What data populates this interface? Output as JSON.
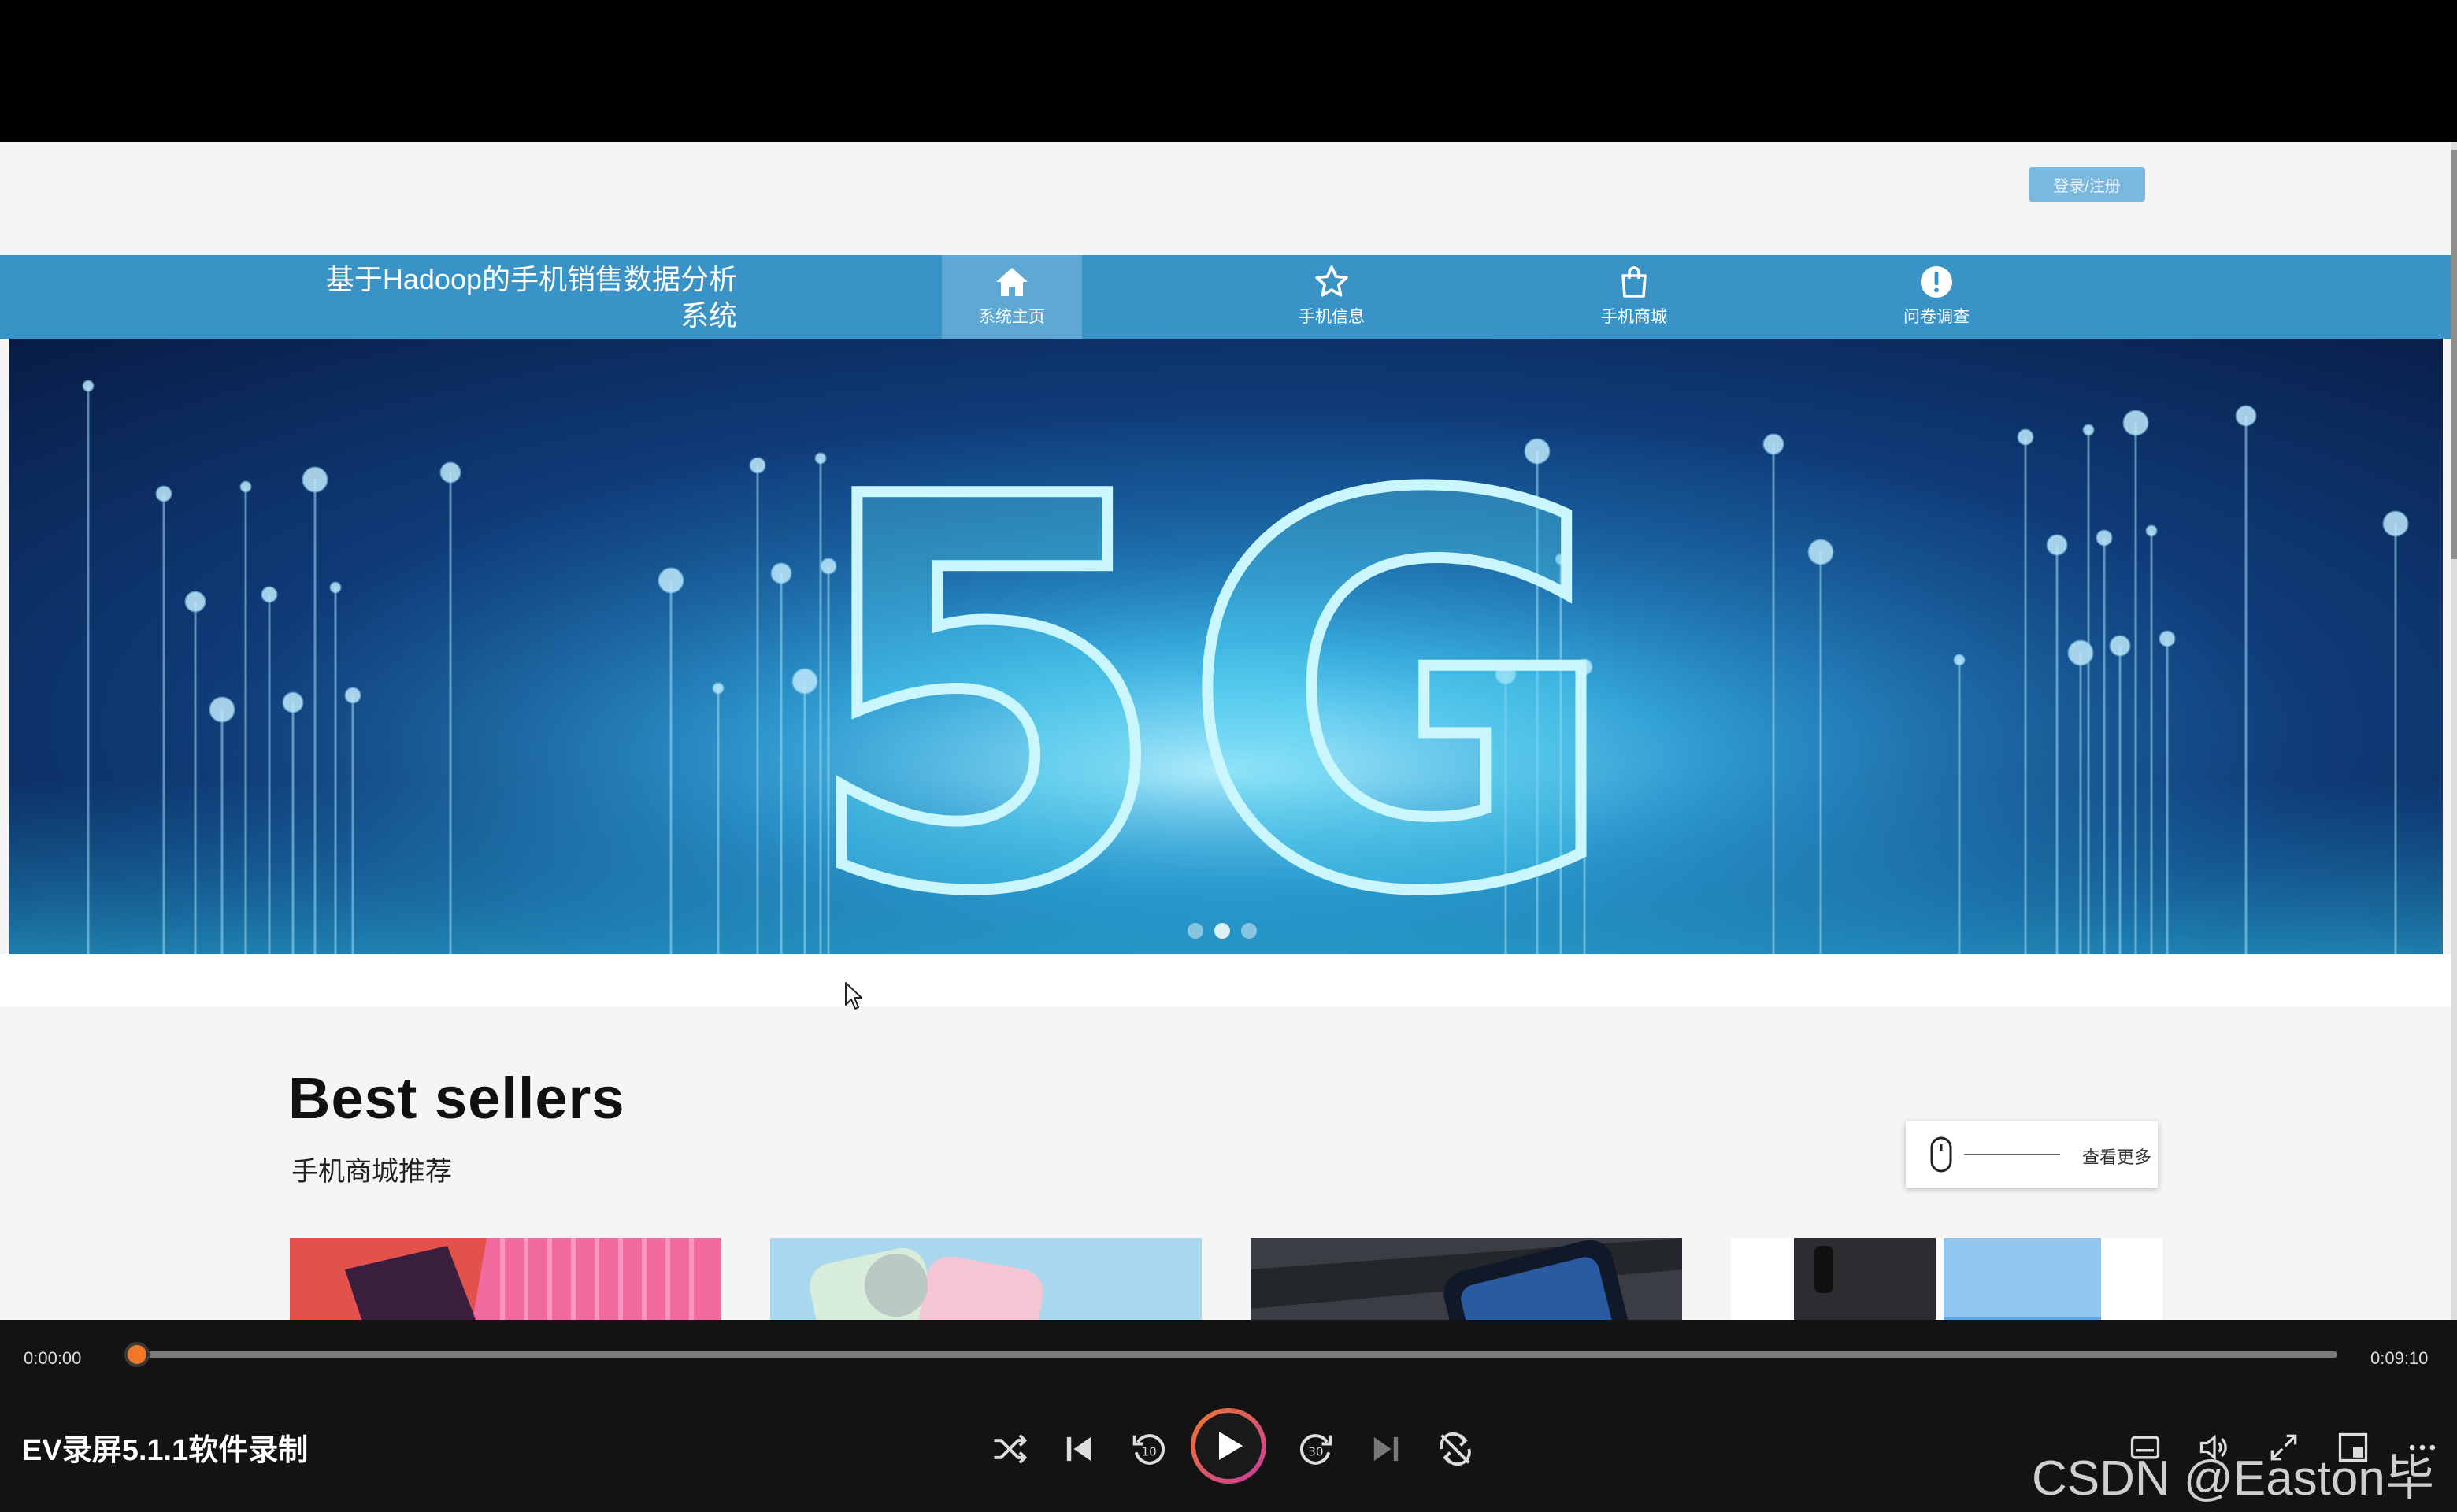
{
  "header": {
    "login_label": "登录/注册"
  },
  "nav": {
    "brand_line1": "基于Hadoop的手机销售数据分析",
    "brand_line2": "系统",
    "items": [
      {
        "label": "系统主页",
        "icon": "home-icon",
        "active": true
      },
      {
        "label": "手机信息",
        "icon": "star-icon",
        "active": false
      },
      {
        "label": "手机商城",
        "icon": "shopping-bag-icon",
        "active": false
      },
      {
        "label": "问卷调查",
        "icon": "exclamation-icon",
        "active": false
      }
    ]
  },
  "banner": {
    "text": "5G",
    "slide_count": 3,
    "active_slide": 2
  },
  "section": {
    "title": "Best sellers",
    "subtitle": "手机商城推荐",
    "more_label": "查看更多"
  },
  "products": [
    {
      "name": "product-1",
      "color": "#e8555a"
    },
    {
      "name": "product-2",
      "color": "#9ccfe6"
    },
    {
      "name": "product-3",
      "color": "#2c3036"
    },
    {
      "name": "product-4",
      "color": "#6ab0e8"
    }
  ],
  "player": {
    "current_time": "0:00:00",
    "total_time": "0:09:10",
    "progress": 0,
    "title": "EV录屏5.1.1软件录制",
    "accent": "#f0782a"
  },
  "watermark": "CSDN @Easton毕设"
}
